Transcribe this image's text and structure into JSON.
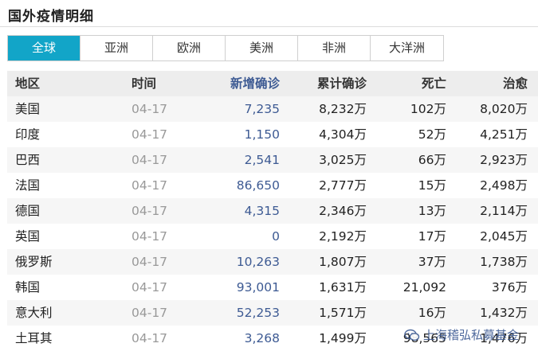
{
  "page_title": "国外疫情明细",
  "tabs": [
    {
      "label": "全球",
      "active": true
    },
    {
      "label": "亚洲",
      "active": false
    },
    {
      "label": "欧洲",
      "active": false
    },
    {
      "label": "美洲",
      "active": false
    },
    {
      "label": "非洲",
      "active": false
    },
    {
      "label": "大洋洲",
      "active": false
    }
  ],
  "table": {
    "headers": {
      "region": "地区",
      "time": "时间",
      "new_confirmed": "新增确诊",
      "cumulative_confirmed": "累计确诊",
      "deaths": "死亡",
      "recovered": "治愈"
    },
    "rows": [
      {
        "region": "美国",
        "time": "04-17",
        "new_confirmed": "7,235",
        "cumulative_confirmed": "8,232万",
        "deaths": "102万",
        "recovered": "8,020万"
      },
      {
        "region": "印度",
        "time": "04-17",
        "new_confirmed": "1,150",
        "cumulative_confirmed": "4,304万",
        "deaths": "52万",
        "recovered": "4,251万"
      },
      {
        "region": "巴西",
        "time": "04-17",
        "new_confirmed": "2,541",
        "cumulative_confirmed": "3,025万",
        "deaths": "66万",
        "recovered": "2,923万"
      },
      {
        "region": "法国",
        "time": "04-17",
        "new_confirmed": "86,650",
        "cumulative_confirmed": "2,777万",
        "deaths": "15万",
        "recovered": "2,498万"
      },
      {
        "region": "德国",
        "time": "04-17",
        "new_confirmed": "4,315",
        "cumulative_confirmed": "2,346万",
        "deaths": "13万",
        "recovered": "2,114万"
      },
      {
        "region": "英国",
        "time": "04-17",
        "new_confirmed": "0",
        "cumulative_confirmed": "2,192万",
        "deaths": "17万",
        "recovered": "2,045万"
      },
      {
        "region": "俄罗斯",
        "time": "04-17",
        "new_confirmed": "10,263",
        "cumulative_confirmed": "1,807万",
        "deaths": "37万",
        "recovered": "1,738万"
      },
      {
        "region": "韩国",
        "time": "04-17",
        "new_confirmed": "93,001",
        "cumulative_confirmed": "1,631万",
        "deaths": "21,092",
        "recovered": "376万"
      },
      {
        "region": "意大利",
        "time": "04-17",
        "new_confirmed": "52,253",
        "cumulative_confirmed": "1,571万",
        "deaths": "16万",
        "recovered": "1,432万"
      },
      {
        "region": "土耳其",
        "time": "04-17",
        "new_confirmed": "3,268",
        "cumulative_confirmed": "1,499万",
        "deaths": "98,565",
        "recovered": "1,476万"
      }
    ]
  },
  "watermark": {
    "text": "上海稽弘私募基金",
    "icon": "wechat-icon"
  },
  "colors": {
    "accent": "#12a5c8",
    "new_confirmed_text": "#3d5a93",
    "time_text": "#999999"
  }
}
